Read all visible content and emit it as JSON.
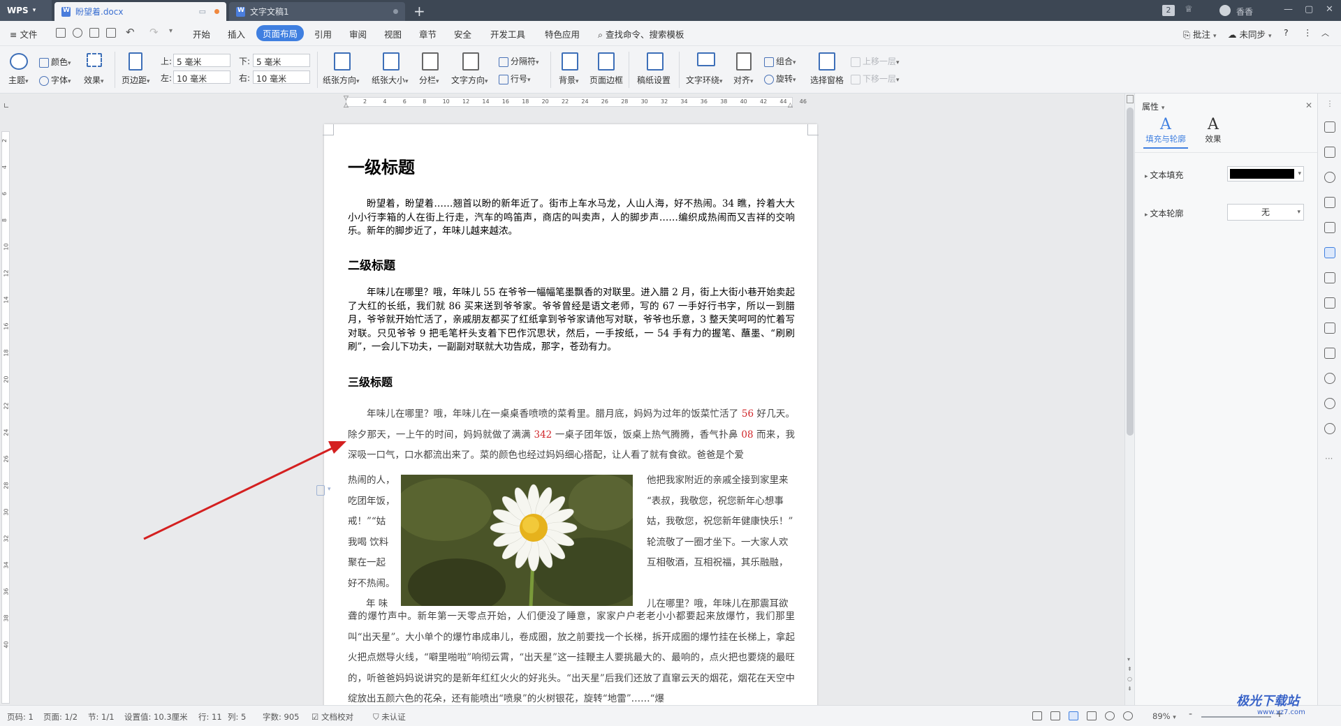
{
  "titlebar": {
    "app": "WPS",
    "tabs": [
      {
        "label": "盼望着.docx"
      },
      {
        "label": "文字文稿1"
      }
    ],
    "new_tab": "+",
    "badge": "2",
    "user": "香香",
    "window_controls": [
      "—",
      "▢",
      "✕"
    ]
  },
  "menubar": {
    "file": "文件",
    "items": [
      "开始",
      "插入",
      "页面布局",
      "引用",
      "审阅",
      "视图",
      "章节",
      "安全",
      "开发工具",
      "特色应用"
    ],
    "active": "页面布局",
    "search": "查找命令、搜索模板",
    "comment": "批注",
    "sync": "未同步",
    "help": "?",
    "more": "⋮"
  },
  "ribbon": {
    "theme": "主题",
    "color": "颜色",
    "font": "字体",
    "effect": "效果",
    "margins": "页边距",
    "top_label": "上:",
    "top_value": "5 毫米",
    "bottom_label": "下:",
    "bottom_value": "5 毫米",
    "left_label": "左:",
    "left_value": "10 毫米",
    "right_label": "右:",
    "right_value": "10 毫米",
    "orientation": "纸张方向",
    "size": "纸张大小",
    "columns": "分栏",
    "text_direction": "文字方向",
    "separator": "分隔符",
    "line_number": "行号",
    "background": "背景",
    "border": "页面边框",
    "manuscript": "稿纸设置",
    "wrap": "文字环绕",
    "align": "对齐",
    "group": "组合",
    "rotate": "旋转",
    "selection_pane": "选择窗格",
    "bring_forward": "上移一层",
    "send_backward": "下移一层"
  },
  "ruler": {
    "h_ticks": [
      "2",
      "4",
      "6",
      "8",
      "10",
      "12",
      "14",
      "16",
      "18",
      "20",
      "22",
      "24",
      "26",
      "28",
      "30",
      "32",
      "34",
      "36",
      "38",
      "40",
      "42",
      "44",
      "46"
    ],
    "v_ticks": [
      "2",
      "4",
      "6",
      "8",
      "10",
      "12",
      "14",
      "16",
      "18",
      "20",
      "22",
      "24",
      "26",
      "28",
      "30",
      "32",
      "34",
      "36",
      "38",
      "40"
    ]
  },
  "document": {
    "h1": "一级标题",
    "p1": "盼望着，盼望着……翘首以盼的新年近了。街市上车水马龙，人山人海，好不热闹。34 瞧，拎着大大小小行李箱的人在街上行走，汽车的鸣笛声，商店的叫卖声，人的脚步声……编织成热闹而又吉祥的交响乐。新年的脚步近了，年味儿越来越浓。",
    "h2": "二级标题",
    "p2": "年味儿在哪里？哦，年味儿 55 在爷爷一幅幅笔墨飘香的对联里。进入腊 2 月，街上大街小巷开始卖起了大红的长纸，我们就 86 买来送到爷爷家。爷爷曾经是语文老师，写的 67 一手好行书字，所以一到腊月，爷爷就开始忙活了，亲戚朋友都买了红纸拿到爷爷家请他写对联，爷爷也乐意，3 整天笑呵呵的忙着写对联。只见爷爷 9 把毛笔杆头支着下巴作沉思状，然后，一手按纸，一 54 手有力的握笔、蘸墨、“刷刷刷”，一会儿下功夫，一副副对联就大功告成，那字，苍劲有力。",
    "h3": "三级标题",
    "p3_a": "年味儿在哪里？哦，年味儿在一桌桌香喷喷的菜肴里。腊月底，妈妈为过年的饭菜忙活了 ",
    "p3_n1": "56",
    "p3_b": " 好几天。除夕那天，一上午的时间，妈妈就做了满满 ",
    "p3_n2": "342",
    "p3_c": " 一桌子团年饭，饭桌上热气腾腾，香气扑鼻 ",
    "p3_n3": "08",
    "p3_d": " 而来，我深吸一口气，口水都流出来了。菜的颜色也经过妈妈细心搭配，让人看了就有食欲。爸爸是个爱",
    "wrap_left": [
      "热闹的人，",
      "吃团年饭，",
      "戒！”“姑",
      "我喝 饮料",
      "聚在一起",
      "好不热闹。"
    ],
    "wrap_right": [
      "他把我家附近的亲戚全接到家里来",
      "“表叔，我敬您，祝您新年心想事",
      "姑，我敬您，祝您新年健康快乐！”",
      "轮流敬了一圈才坐下。一大家人欢",
      "互相敬酒，互相祝福，其乐融融，"
    ],
    "wrap_after_left": "年  味",
    "wrap_after_right": "儿在哪里？哦，年味儿在那震耳欲",
    "p4": "聋的爆竹声中。新年第一天零点开始，人们便没了睡意，家家户户老老小小都要起来放爆竹，我们那里叫“出天星”。大小单个的爆竹串成串儿，卷成圈，放之前要找一个长梯，拆开成圈的爆竹挂在长梯上，拿起火把点燃导火线，“噼里啪啦”响彻云霄，“出天星”这一挂鞭主人要挑最大的、最响的，点火把也要烧的最旺的，听爸爸妈妈说讲究的是新年红红火火的好兆头。“出天星”后我们还放了直窜云天的烟花，烟花在天空中绽放出五颜六色的花朵，还有能喷出“喷泉”的火树银花，旋转“地雷”……“爆"
  },
  "panel": {
    "title": "属性",
    "tab_fill": "填充与轮廓",
    "tab_effect": "效果",
    "glyph": "A",
    "text_fill": "文本填充",
    "text_outline": "文本轮廓",
    "outline_value": "无",
    "fill_color": "#000000"
  },
  "status": {
    "page_code": "页码: 1",
    "page": "页面: 1/2",
    "section": "节: 1/1",
    "setting": "设置值: 10.3厘米",
    "row": "行: 11",
    "col": "列: 5",
    "words": "字数: 905",
    "proof": "文档校对",
    "auth": "未认证",
    "zoom": "89%",
    "zoom_minus": "-",
    "zoom_plus": "+"
  },
  "watermark": {
    "brand": "极光下载站",
    "site": "www.xz7.com"
  },
  "colors": {
    "accent": "#3f7fe0",
    "titlebar": "#3d4754",
    "red_number": "#d0262a",
    "arrow": "#d42020"
  }
}
